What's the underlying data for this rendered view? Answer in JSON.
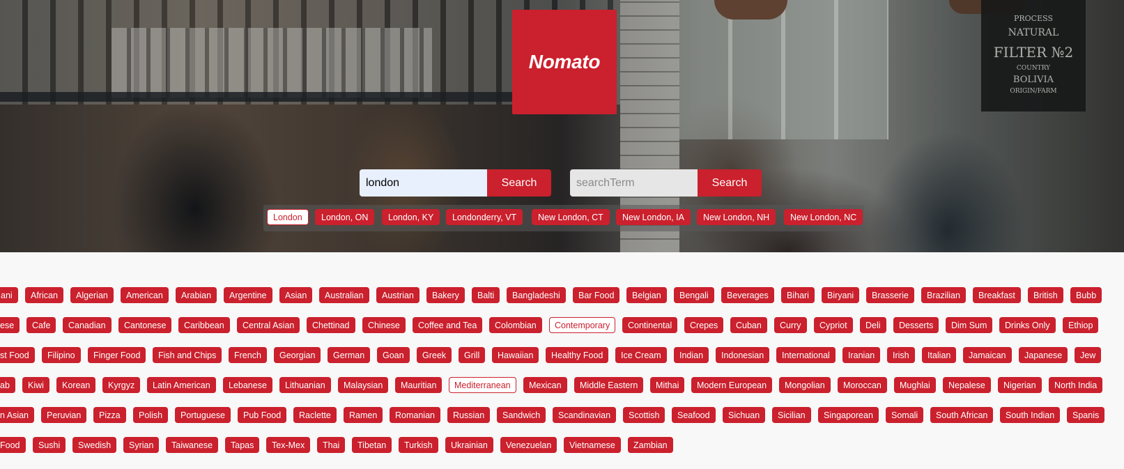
{
  "brand": {
    "logo_text": "Nomato",
    "accent": "#cb202d"
  },
  "location_search": {
    "value": "london",
    "button_label": "Search"
  },
  "term_search": {
    "placeholder": "searchTerm",
    "value": "",
    "button_label": "Search"
  },
  "location_suggestions": [
    "London",
    "London, ON",
    "London, KY",
    "Londonderry, VT",
    "New London, CT",
    "New London, IA",
    "New London, NH",
    "New London, NC"
  ],
  "selected_suggestion": "London",
  "hero_board": {
    "line1": "PROCESS",
    "line2": "NATURAL",
    "line3": "FILTER №2",
    "line4": "COUNTRY",
    "line5": "BOLIVIA",
    "line6": "ORIGIN/FARM"
  },
  "cuisine_rows": [
    [
      "ani",
      "African",
      "Algerian",
      "American",
      "Arabian",
      "Argentine",
      "Asian",
      "Australian",
      "Austrian",
      "Bakery",
      "Balti",
      "Bangladeshi",
      "Bar Food",
      "Belgian",
      "Bengali",
      "Beverages",
      "Bihari",
      "Biryani",
      "Brasserie",
      "Brazilian",
      "Breakfast",
      "British",
      "Bubb"
    ],
    [
      "ese",
      "Cafe",
      "Canadian",
      "Cantonese",
      "Caribbean",
      "Central Asian",
      "Chettinad",
      "Chinese",
      "Coffee and Tea",
      "Colombian",
      "Contemporary",
      "Continental",
      "Crepes",
      "Cuban",
      "Curry",
      "Cypriot",
      "Deli",
      "Desserts",
      "Dim Sum",
      "Drinks Only",
      "Ethiop"
    ],
    [
      "st Food",
      "Filipino",
      "Finger Food",
      "Fish and Chips",
      "French",
      "Georgian",
      "German",
      "Goan",
      "Greek",
      "Grill",
      "Hawaiian",
      "Healthy Food",
      "Ice Cream",
      "Indian",
      "Indonesian",
      "International",
      "Iranian",
      "Irish",
      "Italian",
      "Jamaican",
      "Japanese",
      "Jew"
    ],
    [
      "ab",
      "Kiwi",
      "Korean",
      "Kyrgyz",
      "Latin American",
      "Lebanese",
      "Lithuanian",
      "Malaysian",
      "Mauritian",
      "Mediterranean",
      "Mexican",
      "Middle Eastern",
      "Mithai",
      "Modern European",
      "Mongolian",
      "Moroccan",
      "Mughlai",
      "Nepalese",
      "Nigerian",
      "North India"
    ],
    [
      "n Asian",
      "Peruvian",
      "Pizza",
      "Polish",
      "Portuguese",
      "Pub Food",
      "Raclette",
      "Ramen",
      "Romanian",
      "Russian",
      "Sandwich",
      "Scandinavian",
      "Scottish",
      "Seafood",
      "Sichuan",
      "Sicilian",
      "Singaporean",
      "Somali",
      "South African",
      "South Indian",
      "Spanis"
    ],
    [
      "Food",
      "Sushi",
      "Swedish",
      "Syrian",
      "Taiwanese",
      "Tapas",
      "Tex-Mex",
      "Thai",
      "Tibetan",
      "Turkish",
      "Ukrainian",
      "Venezuelan",
      "Vietnamese",
      "Zambian"
    ]
  ],
  "selected_cuisines": [
    "Contemporary",
    "Mediterranean"
  ]
}
